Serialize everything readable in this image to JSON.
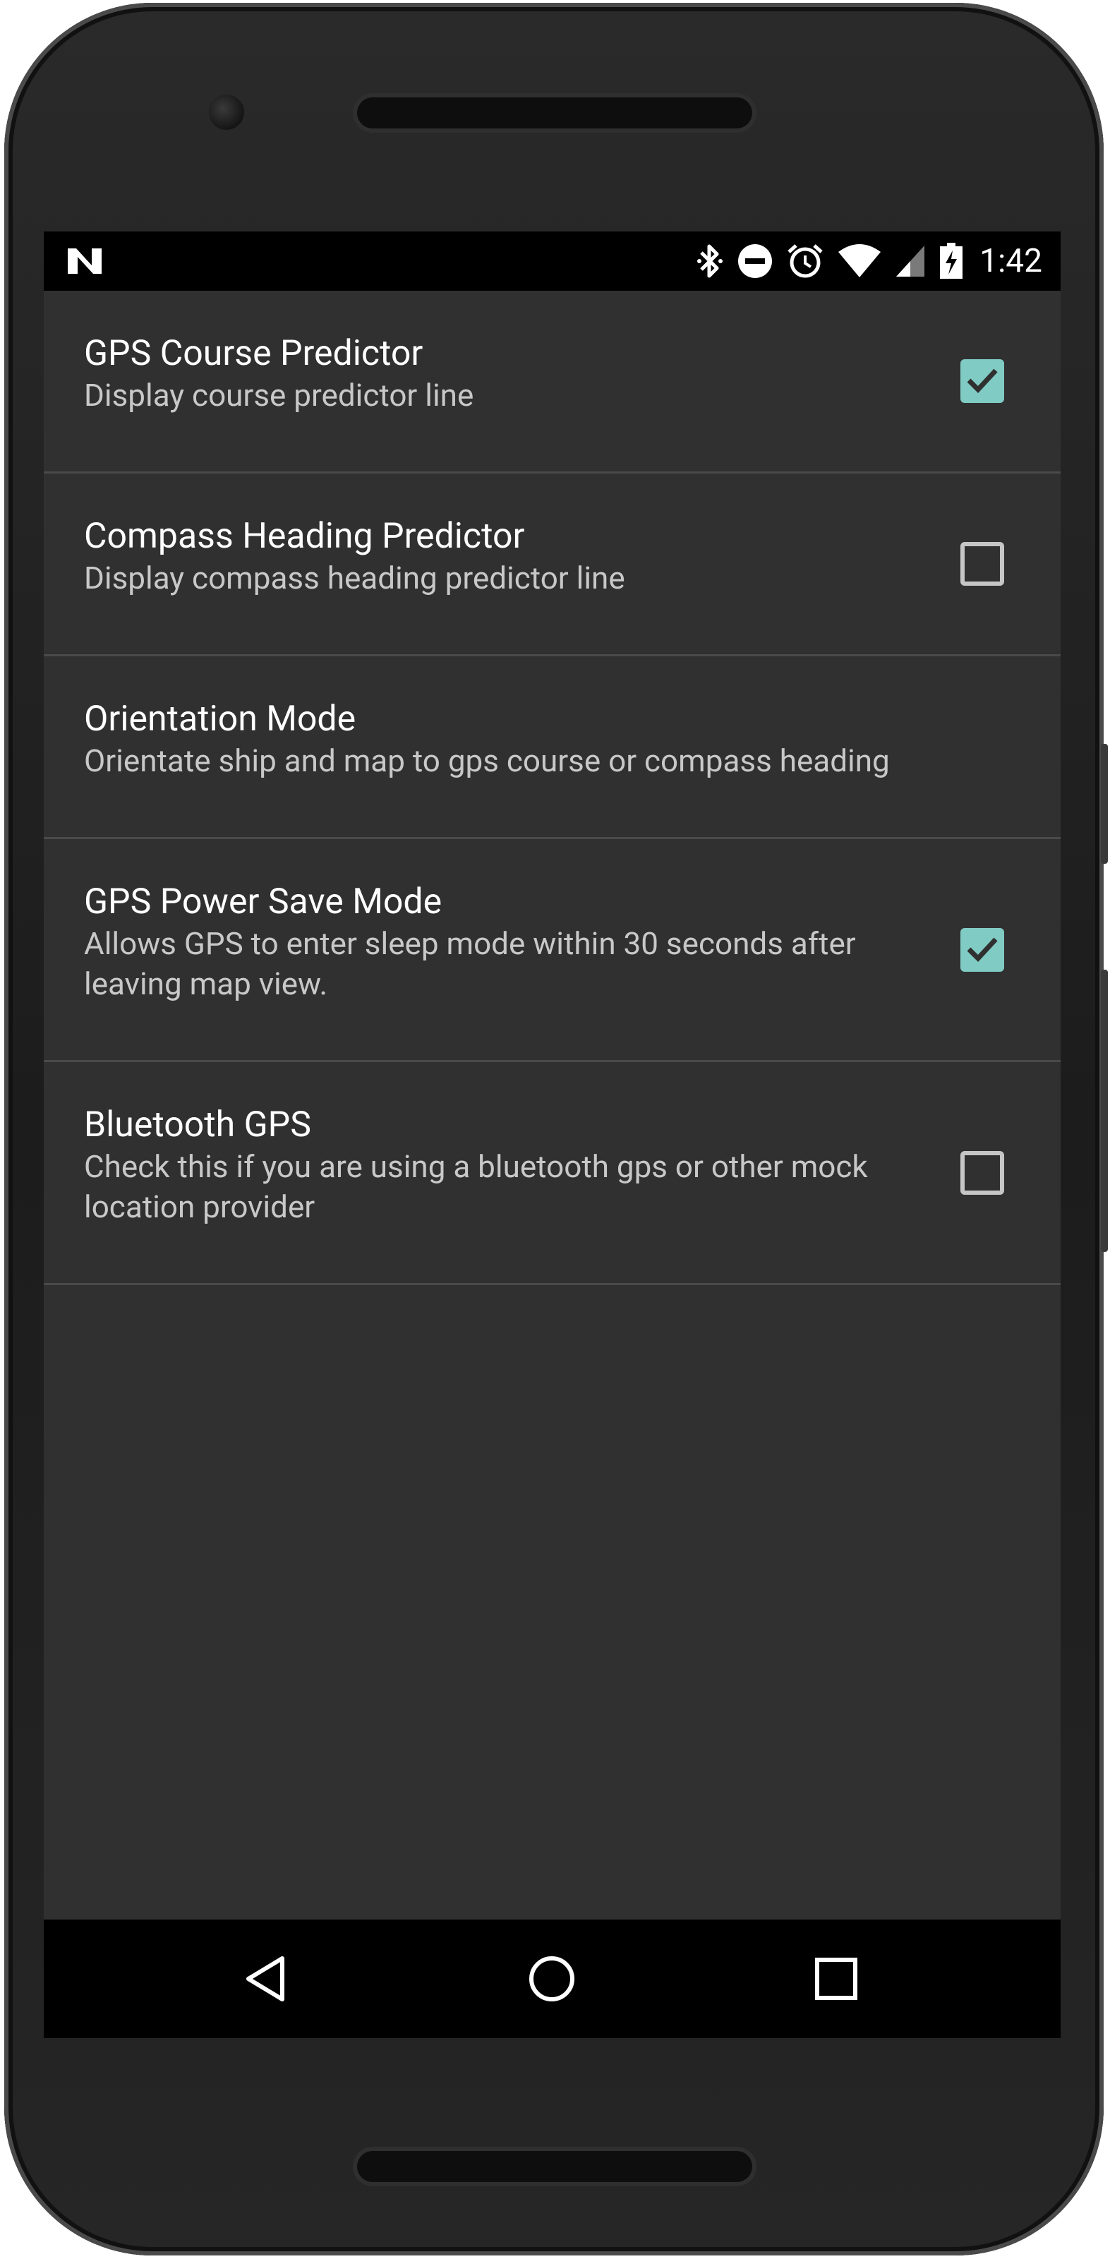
{
  "status_bar": {
    "time": "1:42",
    "left_icon": "n-logo-icon",
    "icons": [
      "bluetooth-icon",
      "do-not-disturb-icon",
      "alarm-icon",
      "wifi-icon",
      "cellular-signal-icon",
      "battery-charging-icon"
    ]
  },
  "preferences": [
    {
      "title": "GPS Course Predictor",
      "summary": "Display course predictor line",
      "checked": true
    },
    {
      "title": "Compass Heading Predictor",
      "summary": "Display compass heading predictor line",
      "checked": false
    },
    {
      "title": "Orientation Mode",
      "summary": "Orientate ship and map to gps course or compass heading",
      "checked": null
    },
    {
      "title": "GPS Power Save Mode",
      "summary": "Allows GPS to enter sleep mode within 30 seconds after leaving map view.",
      "checked": true
    },
    {
      "title": "Bluetooth GPS",
      "summary": "Check this if you are using a bluetooth gps or other mock location provider",
      "checked": false
    }
  ],
  "navigation": {
    "buttons": [
      "back-icon",
      "home-icon",
      "recents-icon"
    ]
  },
  "colors": {
    "accent": "#80cbc4",
    "background": "#303030",
    "divider": "#4a4a4a"
  }
}
